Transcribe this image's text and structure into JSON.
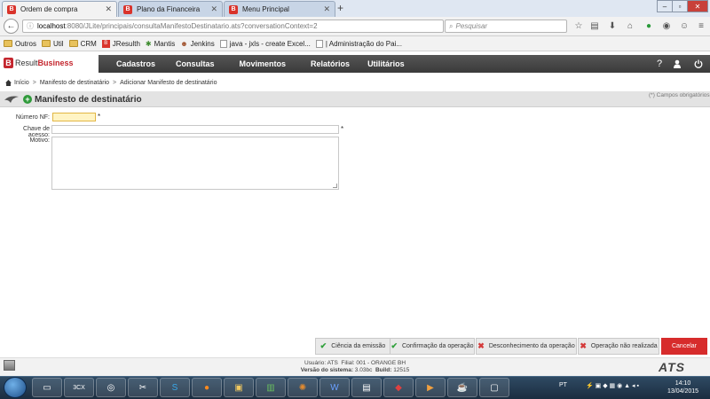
{
  "browser": {
    "tabs": [
      {
        "label": "Ordem de compra",
        "active": true
      },
      {
        "label": "Plano da Financeira",
        "active": false
      },
      {
        "label": "Menu Principal",
        "active": false
      }
    ],
    "url_host": "localhost",
    "url_path": ":8080/JLite/principais/consultaManifestoDestinatario.ats?conversationContext=2",
    "search_placeholder": "Pesquisar",
    "bookmarks": [
      "Outros",
      "Util",
      "CRM",
      "JResulth",
      "Mantis",
      "Jenkins",
      "java - jxls - create Excel...",
      "| Administração do Pai..."
    ]
  },
  "app": {
    "logo_result": "Result",
    "logo_business": "Business",
    "menu": [
      "Cadastros",
      "Consultas",
      "Movimentos",
      "Relatórios",
      "Utilitários"
    ],
    "help_icon": "?",
    "user_icon": "user-icon",
    "power_icon": "power-icon"
  },
  "breadcrumb": [
    "Início",
    "Manifesto de destinatário",
    "Adicionar Manifesto de destinatário"
  ],
  "page": {
    "title": "Manifesto de destinatário",
    "required_note": "(*) Campos obrigatórios"
  },
  "form": {
    "numero_label": "Número NF:",
    "chave_label": "Chave de acesso:",
    "motivo_label": "Motivo:",
    "numero_value": "",
    "chave_value": "",
    "motivo_value": "",
    "required_mark": "*"
  },
  "actions": {
    "ciencia": "Ciência da emissão",
    "confirmacao": "Confirmação da operação",
    "desconhecimento": "Desconhecimento da operação",
    "nao_realizada": "Operação não realizada",
    "cancelar": "Cancelar"
  },
  "footer": {
    "usuario_label": "Usuário:",
    "usuario": "ATS",
    "filial_label": "Filial:",
    "filial": "001 - ORANGE BH",
    "versao_label": "Versão do sistema:",
    "versao": "3.03bc",
    "build_label": "Build:",
    "build": "12515",
    "brand": "ATS"
  },
  "taskbar": {
    "lang": "PT",
    "time": "14:10",
    "date": "13/04/2015",
    "app_3cx": "3CX"
  },
  "colors": {
    "brand_red": "#d72c2c",
    "menubar": "#3f3f3f",
    "ok_green": "#2fa03a",
    "no_red": "#d43a3a"
  }
}
